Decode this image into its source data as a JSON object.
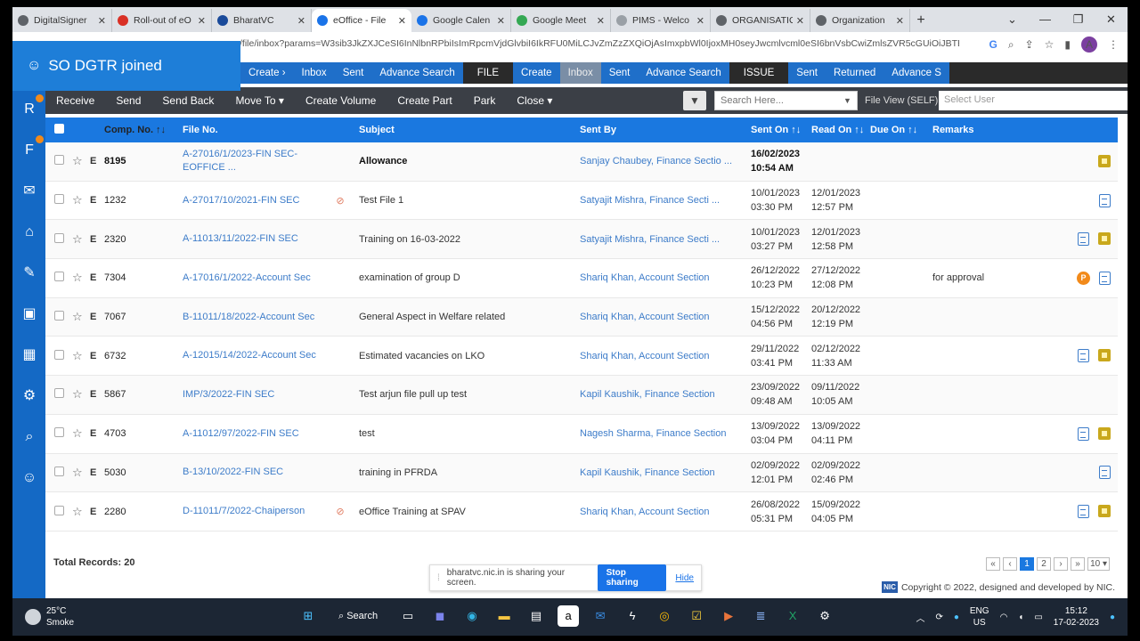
{
  "browser": {
    "tabs": [
      {
        "label": "DigitalSigner",
        "color": "#5f6368",
        "active": false
      },
      {
        "label": "Roll-out of eO",
        "color": "#d93025",
        "active": false
      },
      {
        "label": "BharatVC",
        "color": "#1a4a9a",
        "active": false
      },
      {
        "label": "eOffice - File",
        "color": "#1a73e8",
        "active": true
      },
      {
        "label": "Google Calen",
        "color": "#1a73e8",
        "active": false
      },
      {
        "label": "Google Meet",
        "color": "#34a853",
        "active": false
      },
      {
        "label": "PIMS - Welco",
        "color": "#9aa0a6",
        "active": false
      },
      {
        "label": "ORGANISATIO",
        "color": "#5f6368",
        "active": false
      },
      {
        "label": "Organization",
        "color": "#5f6368",
        "active": false
      }
    ],
    "url": "/file/inbox?params=W3sib3JkZXJCeSI6InNlbnRPbiIsImRpcmVjdGlvbiI6IkRFU0MiLCJvZmZzZXQiOjAsImxpbWl0IjoxMH0seyJwcmlvcml0eSI6bnVsbCwiZmlsZVR5cGUiOiJBTEwi",
    "avatar_letter": "A"
  },
  "banner": {
    "joined_text": "SO DGTR joined"
  },
  "nav": {
    "items": [
      {
        "label": "Create ›",
        "style": "blue"
      },
      {
        "label": "Inbox",
        "style": "blue"
      },
      {
        "label": "Sent",
        "style": "blue"
      },
      {
        "label": "Advance Search",
        "style": "blue"
      },
      {
        "label": "FILE",
        "style": "grp"
      },
      {
        "label": "Create",
        "style": "blue"
      },
      {
        "label": "Inbox",
        "style": "sel"
      },
      {
        "label": "Sent",
        "style": "blue"
      },
      {
        "label": "Advance Search",
        "style": "blue"
      },
      {
        "label": "ISSUE",
        "style": "grp"
      },
      {
        "label": "Sent",
        "style": "blue"
      },
      {
        "label": "Returned",
        "style": "blue"
      },
      {
        "label": "Advance S",
        "style": "blue"
      }
    ]
  },
  "toolbar": {
    "actions": [
      "Receive",
      "Send",
      "Send Back",
      "Move To ▾",
      "Create Volume",
      "Create Part",
      "Park",
      "Close ▾"
    ],
    "search_placeholder": "Search Here...",
    "file_view": "File View (SELF)",
    "select_user": "Select User"
  },
  "table": {
    "headers": {
      "comp_no": "Comp. No. ↑↓",
      "file_no": "File No.",
      "subject": "Subject",
      "sent_by": "Sent By",
      "sent_on": "Sent On ↑↓",
      "read_on": "Read On ↑↓",
      "due_on": "Due On ↑↓",
      "remarks": "Remarks"
    },
    "rows": [
      {
        "type": "E",
        "comp": "8195",
        "file": "A-27016/1/2023-FIN SEC-EOFFICE ...",
        "clip": false,
        "subject": "Allowance",
        "sent_by": "Sanjay Chaubey, Finance Sectio ...",
        "sent_on": "16/02/2023 10:54 AM",
        "read_on": "",
        "due_on": "",
        "remarks": "",
        "unread": true,
        "icons": [
          "folder"
        ]
      },
      {
        "type": "E",
        "comp": "1232",
        "file": "A-27017/10/2021-FIN SEC",
        "clip": true,
        "subject": "Test File 1",
        "sent_by": "Satyajit Mishra, Finance Secti ...",
        "sent_on": "10/01/2023 03:30 PM",
        "read_on": "12/01/2023 12:57 PM",
        "due_on": "",
        "remarks": "",
        "unread": false,
        "icons": [
          "doc"
        ]
      },
      {
        "type": "E",
        "comp": "2320",
        "file": "A-11013/11/2022-FIN SEC",
        "clip": false,
        "subject": "Training on 16-03-2022",
        "sent_by": "Satyajit Mishra, Finance Secti ...",
        "sent_on": "10/01/2023 03:27 PM",
        "read_on": "12/01/2023 12:58 PM",
        "due_on": "",
        "remarks": "",
        "unread": false,
        "icons": [
          "doc",
          "folder"
        ]
      },
      {
        "type": "E",
        "comp": "7304",
        "file": "A-17016/1/2022-Account Sec",
        "clip": false,
        "subject": "examination of group D",
        "sent_by": "Shariq Khan, Account Section",
        "sent_on": "26/12/2022 10:23 PM",
        "read_on": "27/12/2022 12:08 PM",
        "due_on": "",
        "remarks": "for approval",
        "unread": false,
        "icons": [
          "p",
          "doc"
        ]
      },
      {
        "type": "E",
        "comp": "7067",
        "file": "B-11011/18/2022-Account Sec",
        "clip": false,
        "subject": "General Aspect in Welfare related",
        "sent_by": "Shariq Khan, Account Section",
        "sent_on": "15/12/2022 04:56 PM",
        "read_on": "20/12/2022 12:19 PM",
        "due_on": "",
        "remarks": "",
        "unread": false,
        "icons": []
      },
      {
        "type": "E",
        "comp": "6732",
        "file": "A-12015/14/2022-Account Sec",
        "clip": false,
        "subject": "Estimated vacancies on LKO",
        "sent_by": "Shariq Khan, Account Section",
        "sent_on": "29/11/2022 03:41 PM",
        "read_on": "02/12/2022 11:33 AM",
        "due_on": "",
        "remarks": "",
        "unread": false,
        "icons": [
          "doc",
          "folder"
        ]
      },
      {
        "type": "E",
        "comp": "5867",
        "file": "IMP/3/2022-FIN SEC",
        "clip": false,
        "subject": "Test arjun file pull up test",
        "sent_by": "Kapil Kaushik, Finance Section",
        "sent_on": "23/09/2022 09:48 AM",
        "read_on": "09/11/2022 10:05 AM",
        "due_on": "",
        "remarks": "",
        "unread": false,
        "icons": []
      },
      {
        "type": "E",
        "comp": "4703",
        "file": "A-11012/97/2022-FIN SEC",
        "clip": false,
        "subject": "test",
        "sent_by": "Nagesh Sharma, Finance Section",
        "sent_on": "13/09/2022 03:04 PM",
        "read_on": "13/09/2022 04:11 PM",
        "due_on": "",
        "remarks": "",
        "unread": false,
        "icons": [
          "doc",
          "folder"
        ]
      },
      {
        "type": "E",
        "comp": "5030",
        "file": "B-13/10/2022-FIN SEC",
        "clip": false,
        "subject": "training in PFRDA",
        "sent_by": "Kapil Kaushik, Finance Section",
        "sent_on": "02/09/2022 12:01 PM",
        "read_on": "02/09/2022 02:46 PM",
        "due_on": "",
        "remarks": "",
        "unread": false,
        "icons": [
          "doc"
        ]
      },
      {
        "type": "E",
        "comp": "2280",
        "file": "D-11011/7/2022-Chaiperson",
        "clip": true,
        "subject": "eOffice Training at SPAV",
        "sent_by": "Shariq Khan, Account Section",
        "sent_on": "26/08/2022 05:31 PM",
        "read_on": "15/09/2022 04:05 PM",
        "due_on": "",
        "remarks": "",
        "unread": false,
        "icons": [
          "doc",
          "folder"
        ]
      }
    ]
  },
  "footer": {
    "total_records": "Total Records: 20",
    "pager": [
      "«",
      "‹",
      "1",
      "2",
      "›",
      "»",
      "10 ▾"
    ],
    "current_page": "1",
    "share_text": "bharatvc.nic.in is sharing your screen.",
    "stop_sharing": "Stop sharing",
    "hide": "Hide",
    "nic": "NIC",
    "copyright": "Copyright © 2022, designed and developed by NIC."
  },
  "taskbar": {
    "temp": "25°C",
    "weather": "Smoke",
    "search_label": "Search",
    "lang1": "ENG",
    "lang2": "US",
    "time": "15:12",
    "date": "17-02-2023"
  }
}
